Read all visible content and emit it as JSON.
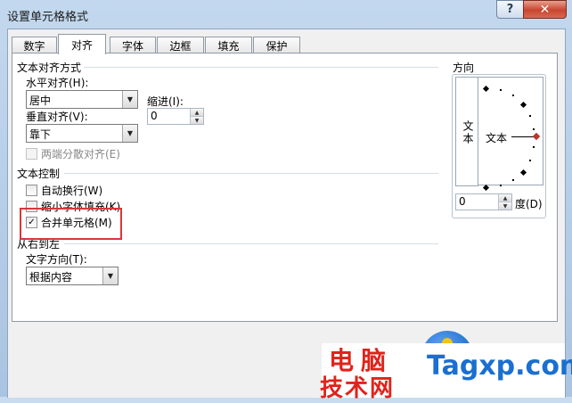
{
  "window": {
    "title": "设置单元格格式",
    "help_label": "?",
    "close_label": "✕"
  },
  "tabs": [
    {
      "label": "数字",
      "active": false
    },
    {
      "label": "对齐",
      "active": true
    },
    {
      "label": "字体",
      "active": false
    },
    {
      "label": "边框",
      "active": false
    },
    {
      "label": "填充",
      "active": false
    },
    {
      "label": "保护",
      "active": false
    }
  ],
  "alignment": {
    "section_title": "文本对齐方式",
    "horizontal_label": "水平对齐(H):",
    "horizontal_value": "居中",
    "indent_label": "缩进(I):",
    "indent_value": "0",
    "vertical_label": "垂直对齐(V):",
    "vertical_value": "靠下",
    "distributed_label": "两端分散对齐(E)"
  },
  "text_control": {
    "section_title": "文本控制",
    "wrap_label": "自动换行(W)",
    "wrap_checked": false,
    "shrink_label": "缩小字体填充(K)",
    "shrink_checked": false,
    "merge_label": "合并单元格(M)",
    "merge_checked": true
  },
  "rtl": {
    "section_title": "从右到左",
    "direction_label": "文字方向(T):",
    "direction_value": "根据内容"
  },
  "orientation": {
    "section_title": "方向",
    "vertical_text": "文本",
    "horizontal_text": "文本",
    "degree_value": "0",
    "degree_label": "度(D)"
  },
  "watermark": {
    "text1": "电脑",
    "text2": "技术网",
    "url": "Tagxp.com",
    "colors": {
      "red": "#e0231b",
      "blue": "#1a6fd0"
    }
  }
}
